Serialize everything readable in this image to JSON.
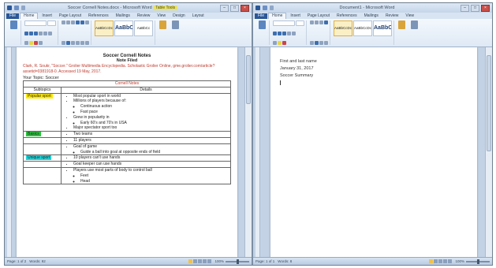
{
  "left_window": {
    "title": "Soccer Cornell Notes.docx - Microsoft Word",
    "title_flag": "Table Tools",
    "tabs": [
      "File",
      "Home",
      "Insert",
      "Page Layout",
      "References",
      "Mailings",
      "Review",
      "View",
      "Design",
      "Layout"
    ],
    "active_tab": "Home",
    "ribbon_styles": [
      "AaBbCcDc",
      "AaBbC",
      "AaBbCc"
    ],
    "ribbon_style_names": [
      "Normal",
      "Heading 1",
      "Heading 2"
    ],
    "change_styles": "Change Styles",
    "editing": "Editing",
    "document": {
      "title": "Soccer Cornell Notes",
      "subtitle": "Note Filed",
      "citation": "Clark, R. Soukr, \"Soccer.\" Grolier Multimedia Encyclopedia. Scholastic Grolier Online, gme.grolier.com/article?assetid=0381918-0. Accessed 19 May, 2017.",
      "topic": "Your Topic: Soccer",
      "table_caption": "Cornell Notes",
      "col_subtopic": "Subtopics",
      "col_details": "Details",
      "rows": [
        {
          "subtopic": "Popular sport",
          "highlight": "#ffea00",
          "details": [
            {
              "text": "Most popular sport in world",
              "sub": []
            },
            {
              "text": "Millions of players because of:",
              "sub": [
                "Continuous action",
                "Fast pace"
              ]
            },
            {
              "text": "Grew in popularity in",
              "sub": [
                "Early 60's and 70's in USA"
              ]
            },
            {
              "text": "Major spectator sport too",
              "sub": []
            }
          ]
        },
        {
          "subtopic": "Basics",
          "highlight": "#26c53a",
          "details": [
            {
              "text": "Two teams",
              "sub": []
            }
          ]
        },
        {
          "subtopic": "",
          "highlight": "",
          "details": [
            {
              "text": "11 players",
              "sub": []
            }
          ]
        },
        {
          "subtopic": "",
          "highlight": "",
          "details": [
            {
              "text": "Goal of game",
              "sub": [
                "Guide a ball into goal at opposite ends of field"
              ]
            }
          ]
        },
        {
          "subtopic": "Unique sport",
          "highlight": "#1fd3d9",
          "details": [
            {
              "text": "10 players can't use hands",
              "sub": []
            }
          ]
        },
        {
          "subtopic": "",
          "highlight": "",
          "details": [
            {
              "text": "Goal keeper can use hands",
              "sub": []
            }
          ]
        },
        {
          "subtopic": "",
          "highlight": "",
          "details": [
            {
              "text": "Players use most parts of body to control ball",
              "sub": [
                "Feet",
                "Head"
              ]
            }
          ]
        }
      ]
    },
    "status": {
      "page": "Page: 1 of 2",
      "words": "Words: 92",
      "zoom": "100%"
    }
  },
  "right_window": {
    "title": "Document1 - Microsoft Word",
    "tabs": [
      "File",
      "Home",
      "Insert",
      "Page Layout",
      "References",
      "Mailings",
      "Review",
      "View"
    ],
    "active_tab": "Home",
    "ribbon_styles": [
      "AaBbCcDc",
      "AaBbCcDc",
      "AaBbC"
    ],
    "ribbon_style_names": [
      "Normal",
      "No Spacing",
      "Heading 1"
    ],
    "change_styles": "Change Styles",
    "editing": "Editing",
    "document_lines": [
      "First and last name",
      "January 31, 2017",
      "Soccer Summary"
    ],
    "status": {
      "page": "Page: 1 of 1",
      "words": "Words: 8",
      "zoom": "100%"
    }
  },
  "colors": {
    "highlight_yellow": "#ffea00",
    "highlight_green": "#26c53a",
    "highlight_cyan": "#1fd3d9",
    "citation_red": "#c0392b",
    "word_blue": "#2b5797"
  }
}
